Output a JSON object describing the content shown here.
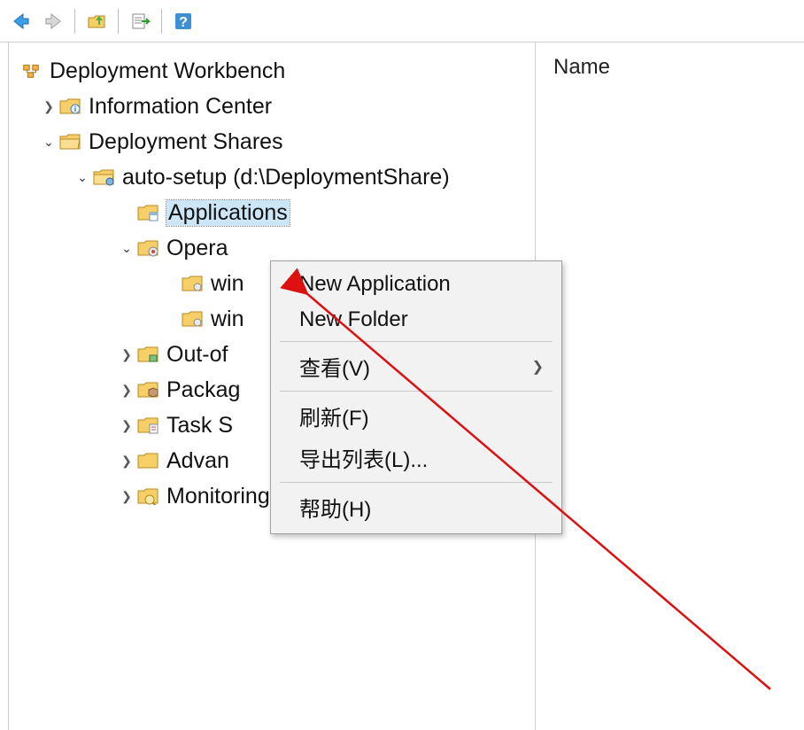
{
  "toolbar": {
    "back": "Back",
    "forward": "Forward",
    "up": "Up",
    "export": "Export",
    "help": "Help"
  },
  "tree": {
    "root": "Deployment Workbench",
    "info_center": "Information Center",
    "dep_shares": "Deployment Shares",
    "share1": "auto-setup (d:\\DeploymentShare)",
    "applications": "Applications",
    "operating": "Opera",
    "win_a": "win",
    "win_b": "win",
    "out_of": "Out-of",
    "packages": "Packag",
    "task_seq": "Task S",
    "advanced": "Advan",
    "monitoring": "Monitoring"
  },
  "right": {
    "name_col": "Name"
  },
  "ctx": {
    "new_app": "New Application",
    "new_folder": "New Folder",
    "view": "查看(V)",
    "refresh": "刷新(F)",
    "export_list": "导出列表(L)...",
    "help": "帮助(H)"
  }
}
